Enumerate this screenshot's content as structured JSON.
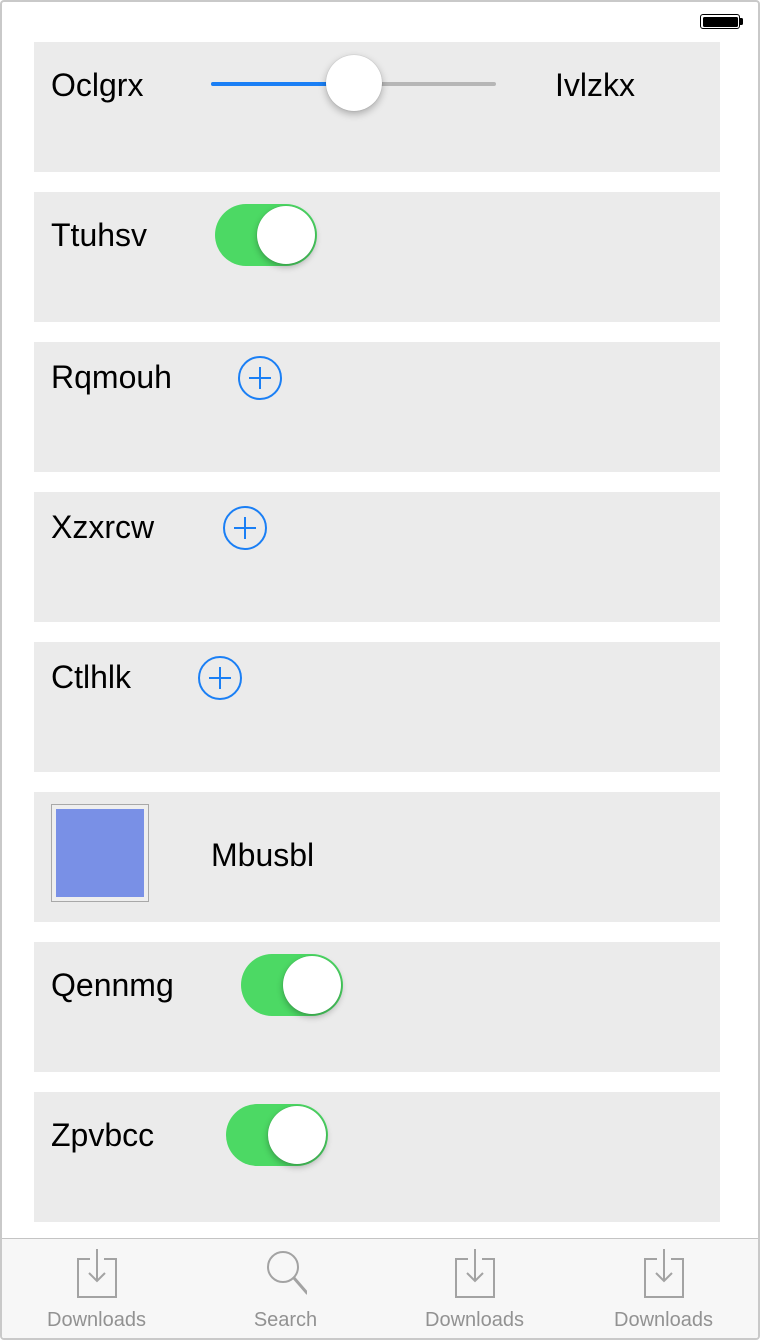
{
  "status_bar": {
    "battery_icon": "battery-full-icon"
  },
  "rows": [
    {
      "type": "slider",
      "label": "Oclgrx",
      "trailing_label": "Ivlzkx",
      "value": 0.5
    },
    {
      "type": "toggle",
      "label": "Ttuhsv",
      "on": true
    },
    {
      "type": "add",
      "label": "Rqmouh",
      "icon": "plus-circle-icon"
    },
    {
      "type": "add",
      "label": "Xzxrcw",
      "icon": "plus-circle-icon"
    },
    {
      "type": "add",
      "label": "Ctlhlk",
      "icon": "plus-circle-icon"
    },
    {
      "type": "color",
      "label": "Mbusbl",
      "swatch_color": "#7990e6"
    },
    {
      "type": "toggle",
      "label": "Qennmg",
      "on": true
    },
    {
      "type": "toggle",
      "label": "Zpvbcc",
      "on": true
    }
  ],
  "tab_bar": {
    "tabs": [
      {
        "label": "Downloads",
        "icon": "download-icon"
      },
      {
        "label": "Search",
        "icon": "search-icon"
      },
      {
        "label": "Downloads",
        "icon": "download-icon"
      },
      {
        "label": "Downloads",
        "icon": "download-icon"
      }
    ]
  },
  "colors": {
    "accent": "#1a7ff5",
    "toggle_on": "#4cd964",
    "row_background": "#ebebeb",
    "tab_label": "#929292"
  }
}
